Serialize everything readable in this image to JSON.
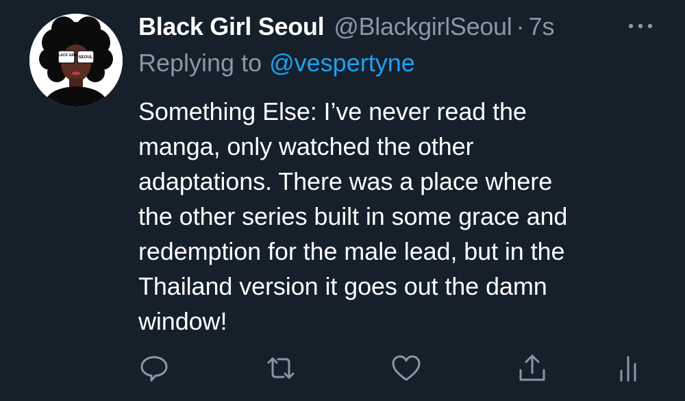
{
  "tweet": {
    "display_name": "Black Girl Seoul",
    "handle": "@BlackgirlSeoul",
    "separator": "·",
    "time": "7s",
    "reply_prefix": "Replying to",
    "reply_to": "@vespertyne",
    "text": "Something Else: I’ve never read the\nmanga, only watched the other\nadaptations.  There was a place where\nthe other series built in some grace and\nredemption for the male lead, but in the\nThailand version it goes out the damn\nwindow!",
    "avatar_text_left": "BLACK GIRL",
    "avatar_text_right": "SEOUL"
  },
  "icons": {
    "more": "more-dots-icon",
    "reply": "reply-icon",
    "retweet": "retweet-icon",
    "like": "heart-icon",
    "share": "share-icon",
    "analytics": "analytics-icon"
  },
  "colors": {
    "background": "#15202b",
    "text_primary": "#ffffff",
    "text_secondary": "#8899a6",
    "link": "#1da1f2"
  }
}
